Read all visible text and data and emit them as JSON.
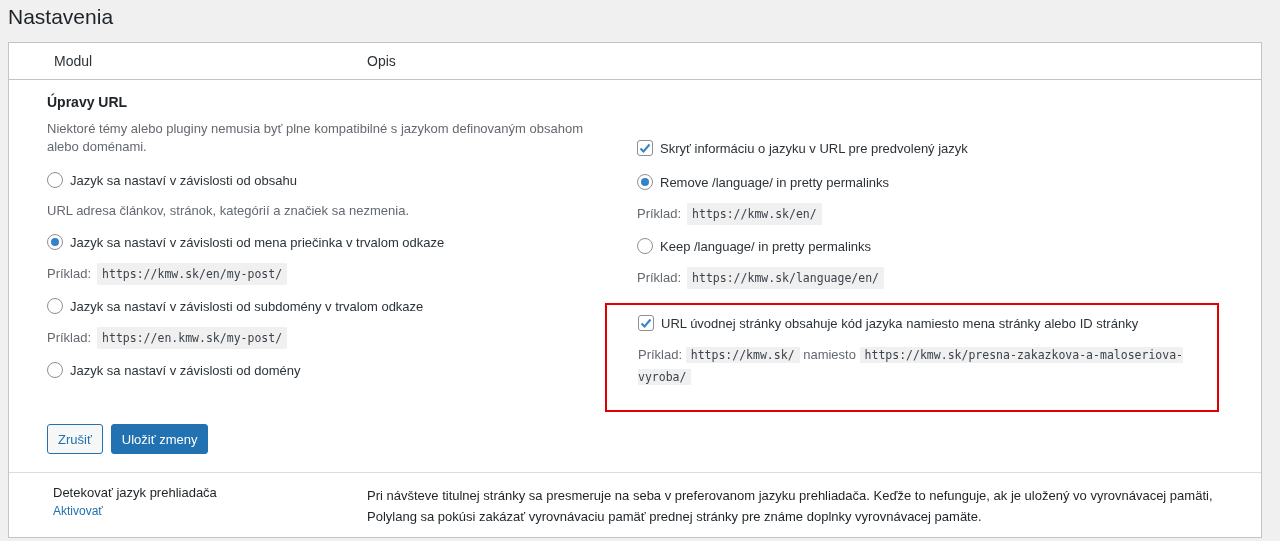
{
  "page_title": "Nastavenia",
  "table": {
    "columns": [
      "Modul",
      "Opis"
    ],
    "section": {
      "title": "Úpravy URL",
      "description": "Niektoré témy alebo pluginy nemusia byť plne kompatibilné s jazykom definovaným obsahom alebo doménami.",
      "left_items": [
        {
          "kind": "radio",
          "label": "Jazyk sa nastaví v závislosti od obsahu",
          "selected": false
        },
        {
          "kind": "note",
          "parts": [
            {
              "kind": "text",
              "text": "URL adresa článkov, stránok, kategórií a značiek sa nezmenia."
            }
          ]
        },
        {
          "kind": "radio",
          "label": "Jazyk sa nastaví v závislosti od mena priečinka v trvalom odkaze",
          "selected": true
        },
        {
          "kind": "note",
          "parts": [
            {
              "kind": "text",
              "text": "Príklad:"
            },
            {
              "kind": "code",
              "text": "https://kmw.sk/en/my-post/"
            }
          ]
        },
        {
          "kind": "radio",
          "label": "Jazyk sa nastaví v závislosti od subdomény v trvalom odkaze",
          "selected": false
        },
        {
          "kind": "note",
          "parts": [
            {
              "kind": "text",
              "text": "Príklad:"
            },
            {
              "kind": "code",
              "text": "https://en.kmw.sk/my-post/"
            }
          ]
        },
        {
          "kind": "radio",
          "label": "Jazyk sa nastaví v závislosti od domény",
          "selected": false
        }
      ],
      "right_groups": [
        {
          "highlighted": false,
          "items": [
            {
              "kind": "checkbox",
              "label": "Skryť informáciu o jazyku v URL pre predvolený jazyk",
              "checked": true
            }
          ]
        },
        {
          "highlighted": false,
          "items": [
            {
              "kind": "radio",
              "label": "Remove /language/ in pretty permalinks",
              "selected": true
            },
            {
              "kind": "note",
              "parts": [
                {
                  "kind": "text",
                  "text": "Príklad:"
                },
                {
                  "kind": "code",
                  "text": "https://kmw.sk/en/"
                }
              ]
            },
            {
              "kind": "radio",
              "label": "Keep /language/ in pretty permalinks",
              "selected": false
            },
            {
              "kind": "note",
              "parts": [
                {
                  "kind": "text",
                  "text": "Príklad:"
                },
                {
                  "kind": "code",
                  "text": "https://kmw.sk/language/en/"
                }
              ]
            }
          ]
        },
        {
          "highlighted": true,
          "items": [
            {
              "kind": "checkbox",
              "label": "URL úvodnej stránky obsahuje kód jazyka namiesto mena stránky alebo ID stránky",
              "checked": true
            },
            {
              "kind": "note",
              "parts": [
                {
                  "kind": "text",
                  "text": "Príklad:"
                },
                {
                  "kind": "code",
                  "text": "https://kmw.sk/"
                },
                {
                  "kind": "text",
                  "text": "namiesto"
                },
                {
                  "kind": "code",
                  "text": "https://kmw.sk/presna-zakazkova-a-maloseriova-vyroba/"
                }
              ]
            }
          ]
        }
      ],
      "buttons": [
        {
          "label": "Zrušiť",
          "kind": "secondary"
        },
        {
          "label": "Uložiť zmeny",
          "kind": "primary"
        }
      ]
    },
    "rows": [
      {
        "module": "Detekovať jazyk prehliadača",
        "action": "Aktivovať",
        "description": "Pri návšteve titulnej stránky sa presmeruje na seba v preferovanom jazyku prehliadača. Keďže to nefunguje, ak je uložený vo vyrovnávacej pamäti, Polylang sa pokúsi zakázať vyrovnávaciu pamäť prednej stránky pre známe doplnky vyrovnávacej pamäte."
      }
    ]
  }
}
